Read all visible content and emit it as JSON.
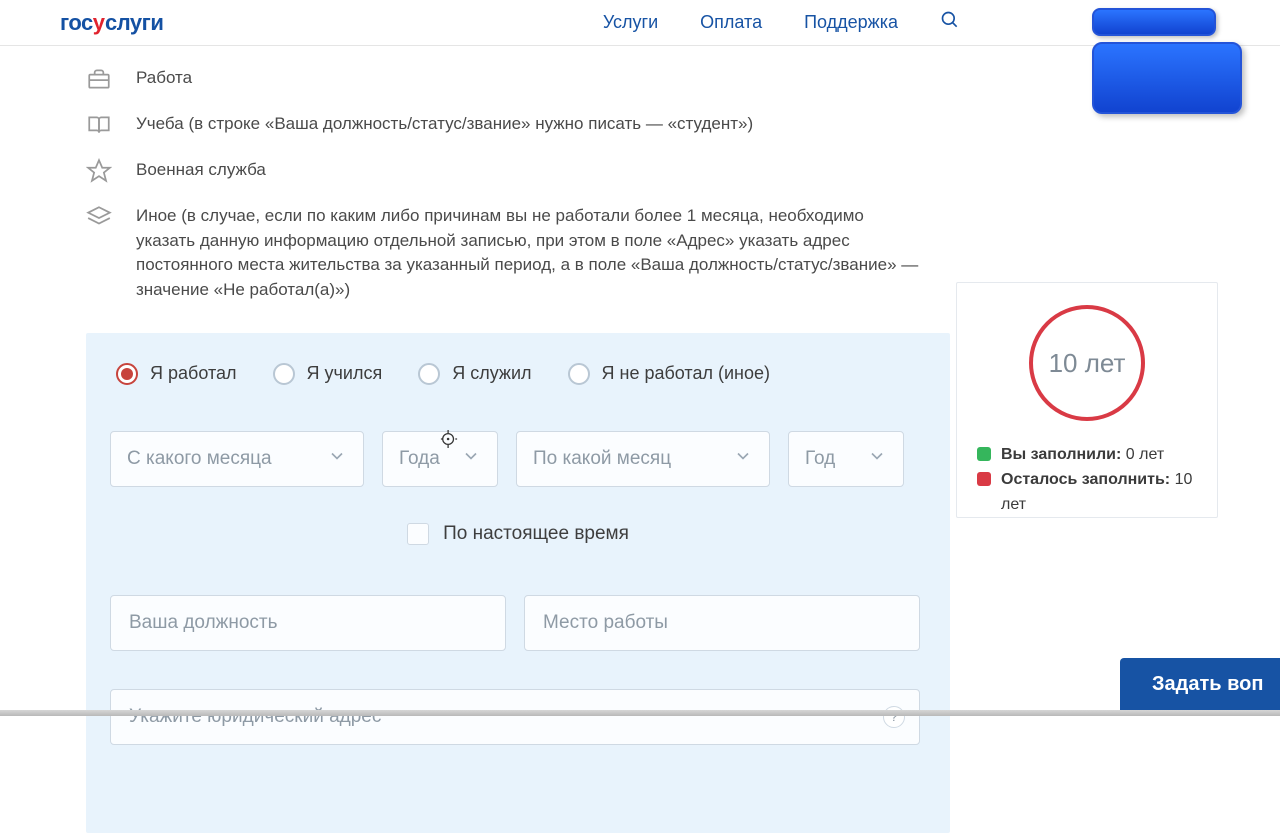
{
  "header": {
    "logo_gos": "гос",
    "logo_y": "у",
    "logo_slugi": "слуги",
    "nav": {
      "services": "Услуги",
      "payment": "Оплата",
      "support": "Поддержка"
    }
  },
  "info": {
    "work": "Работа",
    "study": "Учеба (в строке «Ваша должность/статус/звание» нужно писать — «студент»)",
    "military": "Военная служба",
    "other": "Иное (в случае, если по каким либо причинам вы не работали более 1 месяца, необходимо указать данную информацию отдельной записью, при этом в поле «Адрес» указать адрес постоянного места жительства за указанный период, а в поле «Ваша должность/статус/звание» — значение «Не работал(а)»)"
  },
  "radios": {
    "worked": "Я работал",
    "studied": "Я учился",
    "served": "Я служил",
    "none": "Я не работал (иное)"
  },
  "selects": {
    "from_month": "С какого месяца",
    "from_year": "Года",
    "to_month": "По какой месяц",
    "to_year": "Год"
  },
  "checkbox": {
    "present": "По настоящее время"
  },
  "inputs": {
    "position": "Ваша должность",
    "workplace": "Место работы",
    "address": "Укажите юридический адрес",
    "help": "?"
  },
  "side": {
    "ring_text": "10 лет",
    "filled_label": "Вы заполнили:",
    "filled_value": " 0 лет",
    "remaining_label": "Осталось заполнить:",
    "remaining_value": " 10 лет"
  },
  "ask": {
    "label": "Задать воп"
  }
}
